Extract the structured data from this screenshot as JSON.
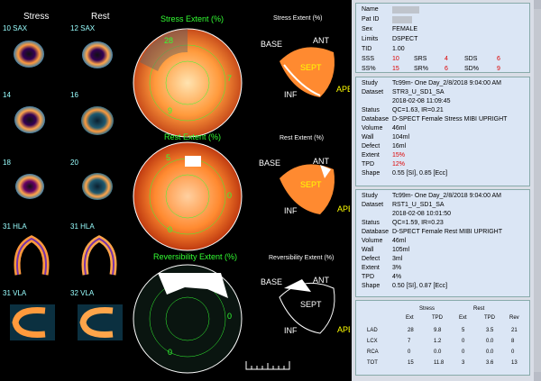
{
  "left": {
    "col_headers": [
      "Stress",
      "Rest"
    ],
    "slice_labels": [
      "10 SAX",
      "12 SAX",
      "14",
      "16",
      "18",
      "20",
      "31 HLA",
      "31 HLA",
      "31 VLA",
      "32 VLA"
    ],
    "panels": {
      "stress_extent": {
        "title": "Stress Extent (%)",
        "nums": [
          "28",
          "7",
          "9"
        ]
      },
      "rest_extent": {
        "title": "Rest Extent (%)",
        "nums": [
          "5",
          "0",
          "0"
        ]
      },
      "reversibility": {
        "title": "Reversibility Extent (%)",
        "nums": [
          "0",
          "0"
        ]
      }
    },
    "bull_titles": [
      "Stress Extent (%)",
      "Rest Extent (%)",
      "Reversibility Extent (%)"
    ],
    "labels": {
      "base": "BASE",
      "ant": "ANT",
      "sept": "SEPT",
      "inf": "INF",
      "apex": "APEX"
    }
  },
  "patient": {
    "name_key": "Name",
    "patid_key": "Pat ID",
    "sex_key": "Sex",
    "sex": "FEMALE",
    "limits_key": "Limits",
    "limits": "DSPECT",
    "tid_key": "TID",
    "tid": "1.00",
    "sss_key": "SSS",
    "sss": "10",
    "srs_key": "SRS",
    "srs": "4",
    "sds_key": "SDS",
    "sds": "6",
    "ssp_key": "SS%",
    "ssp": "15",
    "srp_key": "SR%",
    "srp": "6",
    "sdp_key": "SD%",
    "sdp": "9"
  },
  "stress": {
    "study_key": "Study",
    "study": "Tc99m- One Day_2/8/2018 9:04:00 AM",
    "dataset_key": "Dataset",
    "dataset": "STR3_U_SD1_SA",
    "date": "2018-02-08 11:09:45",
    "status_key": "Status",
    "status": "QC=1.63, IR=0.21",
    "database_key": "Database",
    "database": "D-SPECT Female Stress MIBI UPRIGHT",
    "volume_key": "Volume",
    "volume": "46ml",
    "wall_key": "Wall",
    "wall": "104ml",
    "defect_key": "Defect",
    "defect": "16ml",
    "extent_key": "Extent",
    "extent": "15%",
    "tpd_key": "TPD",
    "tpd": "12%",
    "shape_key": "Shape",
    "shape": "0.55 [SI], 0.85 [Ecc]"
  },
  "rest": {
    "study_key": "Study",
    "study": "Tc99m- One Day_2/8/2018 9:04:00 AM",
    "dataset_key": "Dataset",
    "dataset": "RST1_U_SD1_SA",
    "date": "2018-02-08 10:01:50",
    "status_key": "Status",
    "status": "QC=1.59, IR=0.23",
    "database_key": "Database",
    "database": "D-SPECT Female Rest MIBI UPRIGHT",
    "volume_key": "Volume",
    "volume": "46ml",
    "wall_key": "Wall",
    "wall": "105ml",
    "defect_key": "Defect",
    "defect": "3ml",
    "extent_key": "Extent",
    "extent": "3%",
    "tpd_key": "TPD",
    "tpd": "4%",
    "shape_key": "Shape",
    "shape": "0.50 [SI], 0.87 [Ecc]"
  },
  "table": {
    "group_stress": "Stress",
    "group_rest": "Rest",
    "headers": [
      "Ext",
      "TPD",
      "Ext",
      "TPD",
      "Rev"
    ],
    "rows": [
      {
        "name": "LAD",
        "vals": [
          "28",
          "9.8",
          "5",
          "3.5",
          "21"
        ]
      },
      {
        "name": "LCX",
        "vals": [
          "7",
          "1.2",
          "0",
          "0.0",
          "8"
        ]
      },
      {
        "name": "RCA",
        "vals": [
          "0",
          "0.0",
          "0",
          "0.0",
          "0"
        ]
      },
      {
        "name": "TOT",
        "vals": [
          "15",
          "11.8",
          "3",
          "3.6",
          "13"
        ]
      }
    ]
  }
}
